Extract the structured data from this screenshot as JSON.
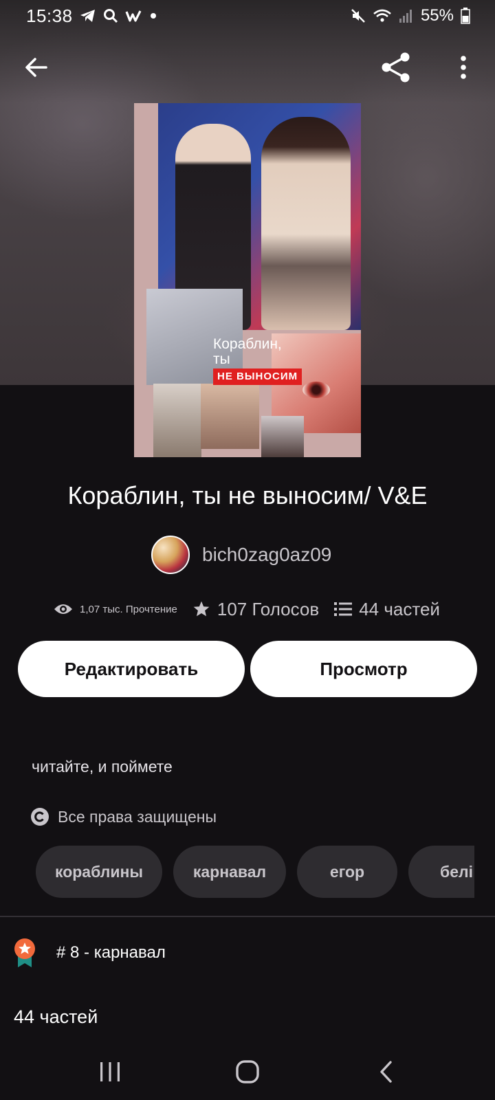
{
  "status_bar": {
    "time": "15:38",
    "battery": "55%",
    "icons": [
      "telegram-icon",
      "search-icon",
      "w-app-icon",
      "dot-icon",
      "mute-icon",
      "wifi-icon",
      "signal-icon",
      "battery-icon"
    ]
  },
  "app_bar": {
    "icons": [
      "back-arrow-icon",
      "share-icon",
      "more-vert-icon"
    ]
  },
  "cover": {
    "text_line1": "Кораблин,",
    "text_line2": "ты",
    "text_highlight": "НЕ ВЫНОСИМ"
  },
  "story": {
    "title": "Кораблин, ты не выносим/ V&E",
    "author": "bich0zag0az09",
    "reads": "1,07 тыс. Прочтение",
    "votes": "107 Голосов",
    "parts": "44 частей",
    "description": "читайте, и поймете",
    "rights": "Все права защищены"
  },
  "buttons": {
    "edit": "Редактировать",
    "view": "Просмотр"
  },
  "tags": [
    "кораблины",
    "карнавал",
    "егор",
    "белі"
  ],
  "ranking": {
    "label": "# 8 - карнавал"
  },
  "parts_section": {
    "label": "44 частей"
  },
  "colors": {
    "background": "#121013",
    "button_bg": "#ffffff",
    "tag_bg": "#2e2c30",
    "badge_orange": "#f26a3c",
    "badge_teal": "#1f8f86"
  }
}
